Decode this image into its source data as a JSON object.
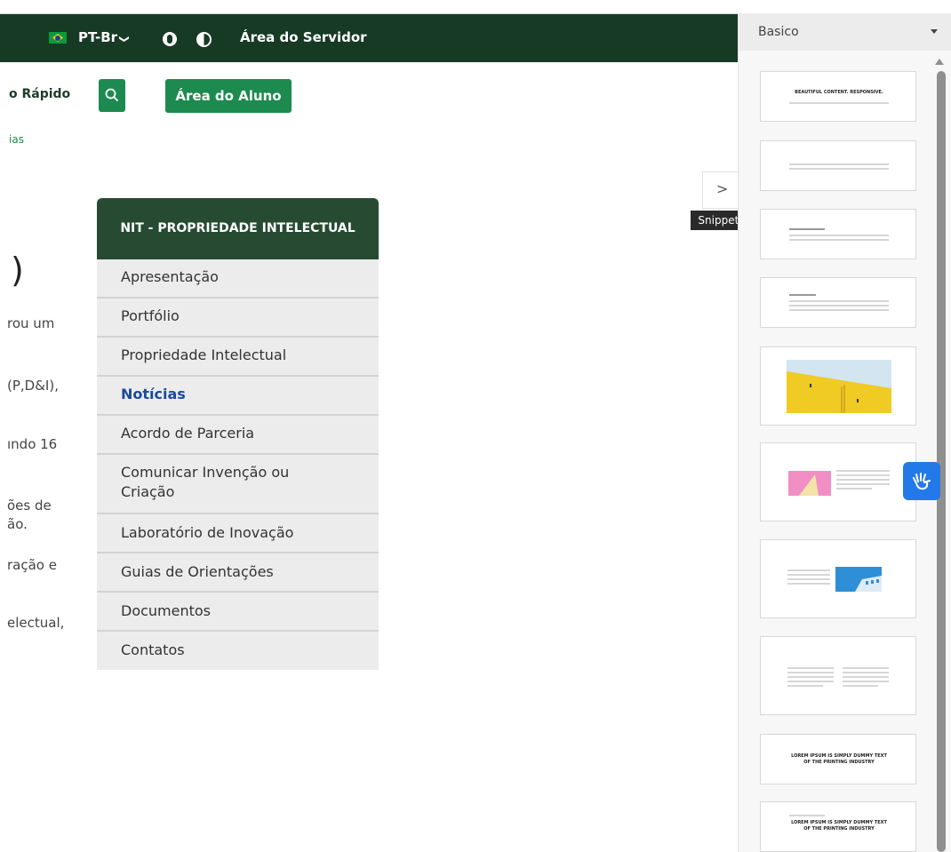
{
  "topbar": {
    "language": "PT-Br",
    "language_caret": "❯",
    "server_area": "Área do Servidor"
  },
  "header": {
    "quick_access": "o Rápido",
    "student_area_button": "Área do Aluno"
  },
  "breadcrumb": {
    "partial": "ias"
  },
  "page": {
    "title_fragment": ")",
    "body_fragments": [
      "rou  um",
      "(P,D&I),",
      "ındo  16",
      "ões  de",
      "ão.",
      "ração  e",
      "electual,"
    ]
  },
  "nav": {
    "header": "NIT - PROPRIEDADE INTELECTUAL",
    "items": [
      {
        "label": "Apresentação"
      },
      {
        "label": "Portfólio"
      },
      {
        "label": "Propriedade Intelectual"
      },
      {
        "label": "Notícias",
        "active": true
      },
      {
        "label": "Acordo de Parceria"
      },
      {
        "label": "Comunicar Invenção ou Criação"
      },
      {
        "label": "Laboratório de Inovação"
      },
      {
        "label": "Guias de Orientações"
      },
      {
        "label": "Documentos"
      },
      {
        "label": "Contatos"
      }
    ]
  },
  "snippets_panel": {
    "category": "Basico",
    "toggle_label": "Snippets",
    "toggle_glyph": ">",
    "snippet_titles": [
      "BEAUTIFUL CONTENT. RESPONSIVE.",
      "LOREM IPSUM IS SIMPLY DUMMY TEXT OF THE PRINTING INDUSTRY",
      "LOREM IPSUM IS SIMPLY DUMMY TEXT OF THE PRINTING INDUSTRY"
    ]
  },
  "colors": {
    "topbar": "#173a25",
    "accent_green": "#1d8a4f",
    "nav_header": "#274a33",
    "active_link": "#1a4a9c",
    "vlibras_blue": "#2479e8"
  },
  "icons": [
    "brazil-flag-icon",
    "accessibility-icon",
    "contrast-icon",
    "search-icon",
    "chevron-right-icon",
    "caret-down-icon",
    "sign-language-hand-icon"
  ]
}
